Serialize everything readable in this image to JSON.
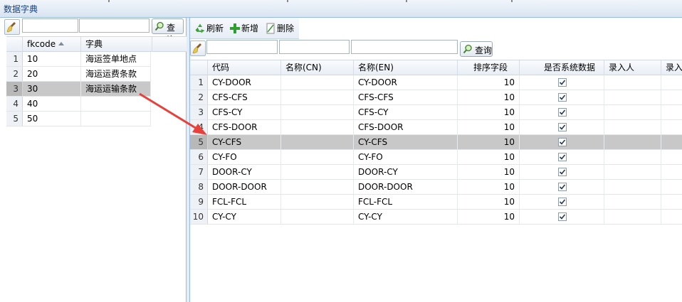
{
  "window": {
    "title": "数据字典"
  },
  "left": {
    "query_label": "查询",
    "columns": [
      "fkcode",
      "字典"
    ],
    "rows": [
      {
        "num": "1",
        "fkcode": "10",
        "name": "海运签单地点",
        "selected": false
      },
      {
        "num": "2",
        "fkcode": "20",
        "name": "海运运费条款",
        "selected": false
      },
      {
        "num": "3",
        "fkcode": "30",
        "name": "海运运输条款",
        "selected": true
      },
      {
        "num": "4",
        "fkcode": "40",
        "name": "",
        "selected": false
      },
      {
        "num": "5",
        "fkcode": "50",
        "name": "",
        "selected": false
      }
    ]
  },
  "right": {
    "toolbar": {
      "refresh": "刷新",
      "add": "新增",
      "delete": "删除"
    },
    "query_label": "查询",
    "columns": [
      "代码",
      "名称(CN)",
      "名称(EN)",
      "排序字段",
      "是否系统数据",
      "录入人",
      "录入"
    ],
    "rows": [
      {
        "num": "1",
        "code": "CY-DOOR",
        "cn": "",
        "en": "CY-DOOR",
        "sort": "10",
        "system": true,
        "selected": false
      },
      {
        "num": "2",
        "code": "CFS-CFS",
        "cn": "",
        "en": "CFS-CFS",
        "sort": "10",
        "system": true,
        "selected": false
      },
      {
        "num": "3",
        "code": "CFS-CY",
        "cn": "",
        "en": "CFS-CY",
        "sort": "10",
        "system": true,
        "selected": false
      },
      {
        "num": "4",
        "code": "CFS-DOOR",
        "cn": "",
        "en": "CFS-DOOR",
        "sort": "10",
        "system": true,
        "selected": false
      },
      {
        "num": "5",
        "code": "CY-CFS",
        "cn": "",
        "en": "CY-CFS",
        "sort": "10",
        "system": true,
        "selected": true
      },
      {
        "num": "6",
        "code": "CY-FO",
        "cn": "",
        "en": "CY-FO",
        "sort": "10",
        "system": true,
        "selected": false
      },
      {
        "num": "7",
        "code": "DOOR-CY",
        "cn": "",
        "en": "DOOR-CY",
        "sort": "10",
        "system": true,
        "selected": false
      },
      {
        "num": "8",
        "code": "DOOR-DOOR",
        "cn": "",
        "en": "DOOR-DOOR",
        "sort": "10",
        "system": true,
        "selected": false
      },
      {
        "num": "9",
        "code": "FCL-FCL",
        "cn": "",
        "en": "FCL-FCL",
        "sort": "10",
        "system": true,
        "selected": false
      },
      {
        "num": "10",
        "code": "CY-CY",
        "cn": "",
        "en": "CY-CY",
        "sort": "10",
        "system": true,
        "selected": false
      }
    ]
  },
  "colors": {
    "selected_row": "#c8c8c8",
    "annotation_arrow": "#e8403a"
  }
}
